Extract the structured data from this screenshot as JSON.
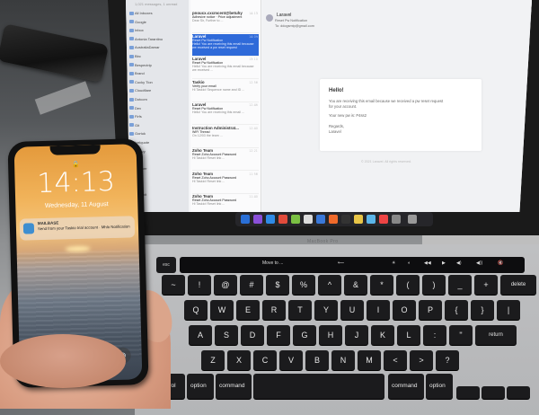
{
  "phone": {
    "time": "14:13",
    "date": "Wednesday, 11 August",
    "notification": {
      "app": "MAILBASE",
      "body": "Send from your Taskio trial account · Mhlo Notification"
    },
    "swipe_hint": "Swipe up to open"
  },
  "mail": {
    "top_hint": "1,021 messages, 1 unread",
    "sidebar": [
      "All Inboxes",
      "Google",
      "Inbox",
      "Antonia Tarantino",
      "AustraliaDamar",
      "Bbc",
      "Bespectrip",
      "Brand",
      "Cucky Tion",
      "Cloudflare",
      "Dotcom",
      "Dev",
      "Firfs",
      "Git",
      "Gortuk",
      "Icelquote",
      "Kwavy",
      "lined",
      "Moaner",
      "MP",
      "M3",
      "Moamit",
      "Mona"
    ],
    "messages": [
      {
        "from": "pnoucx.cxcmcent@betuhy",
        "subj": "Adhesive notice · Price adjustment",
        "prev": "Dear Sir, Further to ...",
        "time": "14:13",
        "selected": false
      },
      {
        "from": "Laravel",
        "subj": "Reset Pw Notification",
        "prev": "Hello! You are receiving this email because we received a pw reset request",
        "time": "14:09",
        "selected": true
      },
      {
        "from": "Laravel",
        "subj": "Reset Pw Notification",
        "prev": "Hello! You are receiving this email because we received ...",
        "time": "13:10",
        "selected": false
      },
      {
        "from": "Taskio",
        "subj": "Verify your email",
        "prev": "Hi Taskio! Sequence name and ID ...",
        "time": "12:58",
        "selected": false
      },
      {
        "from": "Laravel",
        "subj": "Reset Pw Notification",
        "prev": "Hello! You are receiving this email ...",
        "time": "12:46",
        "selected": false
      },
      {
        "from": "Instruction Administrat...",
        "subj": "WiFi Thread",
        "prev": "On 12/03 the team ...",
        "time": "12:40",
        "selected": false
      },
      {
        "from": "Zoho Team",
        "subj": "Reset Zoho Account Password",
        "prev": "Hi Taskio! Reset link ...",
        "time": "12:21",
        "selected": false
      },
      {
        "from": "Zoho Team",
        "subj": "Reset Zoho Account Password",
        "prev": "Hi Taskio! Reset link ...",
        "time": "11:58",
        "selected": false
      },
      {
        "from": "Zoho Team",
        "subj": "Reset Zoho Account Password",
        "prev": "Hi Taskio! Reset link ...",
        "time": "11:40",
        "selected": false
      }
    ],
    "reader": {
      "from": "Laravel",
      "subject": "Reset Pw Notification",
      "to": "To: ddogsmtp@gmail.com",
      "greeting": "Hello!",
      "lines": [
        "You are receiving this email because we received a pw reset request",
        "for your account.",
        "Your new pw is: P4ss2",
        "Regards,",
        "Laravel"
      ],
      "footer": "© 2021 Laravel. All rights reserved."
    }
  },
  "laptop": {
    "brand": "MacBook Pro"
  },
  "touchbar": [
    "Move to ...",
    "⟵",
    "☀",
    "◐",
    "◀◀",
    "▶",
    "◀)",
    "◀))",
    "🔇"
  ],
  "keyboard": {
    "esc": "esc",
    "row1": [
      "~",
      "!",
      "@",
      "#",
      "$",
      "%",
      "^",
      "&",
      "*",
      "(",
      ")",
      "_",
      "+",
      "delete"
    ],
    "row2": [
      "Q",
      "W",
      "E",
      "R",
      "T",
      "Y",
      "U",
      "I",
      "O",
      "P",
      "{",
      "}",
      "|"
    ],
    "row3": [
      "A",
      "S",
      "D",
      "F",
      "G",
      "H",
      "J",
      "K",
      "L",
      ":",
      "\"",
      "return"
    ],
    "row4": [
      "Z",
      "X",
      "C",
      "V",
      "B",
      "N",
      "M",
      "<",
      ">",
      "?"
    ],
    "mods": [
      "control",
      "option",
      "command",
      "command",
      "option"
    ]
  },
  "colors": {
    "selection": "#2f6ad9",
    "key": "#1b1b1d",
    "deck": "#b9babc"
  }
}
